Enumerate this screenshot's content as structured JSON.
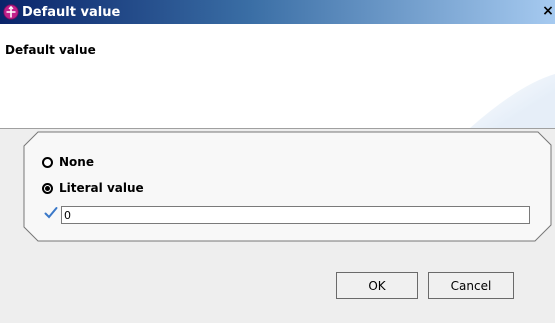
{
  "window": {
    "title": "Default value",
    "close_glyph": "×",
    "app_icon": "eclipse-magenta-icon"
  },
  "banner": {
    "title": "Default value"
  },
  "options": {
    "none_label": "None",
    "literal_label": "Literal value",
    "selected": "literal"
  },
  "literal": {
    "value": "0",
    "status_icon": "checkmark-icon"
  },
  "buttons": {
    "ok_label": "OK",
    "cancel_label": "Cancel"
  }
}
